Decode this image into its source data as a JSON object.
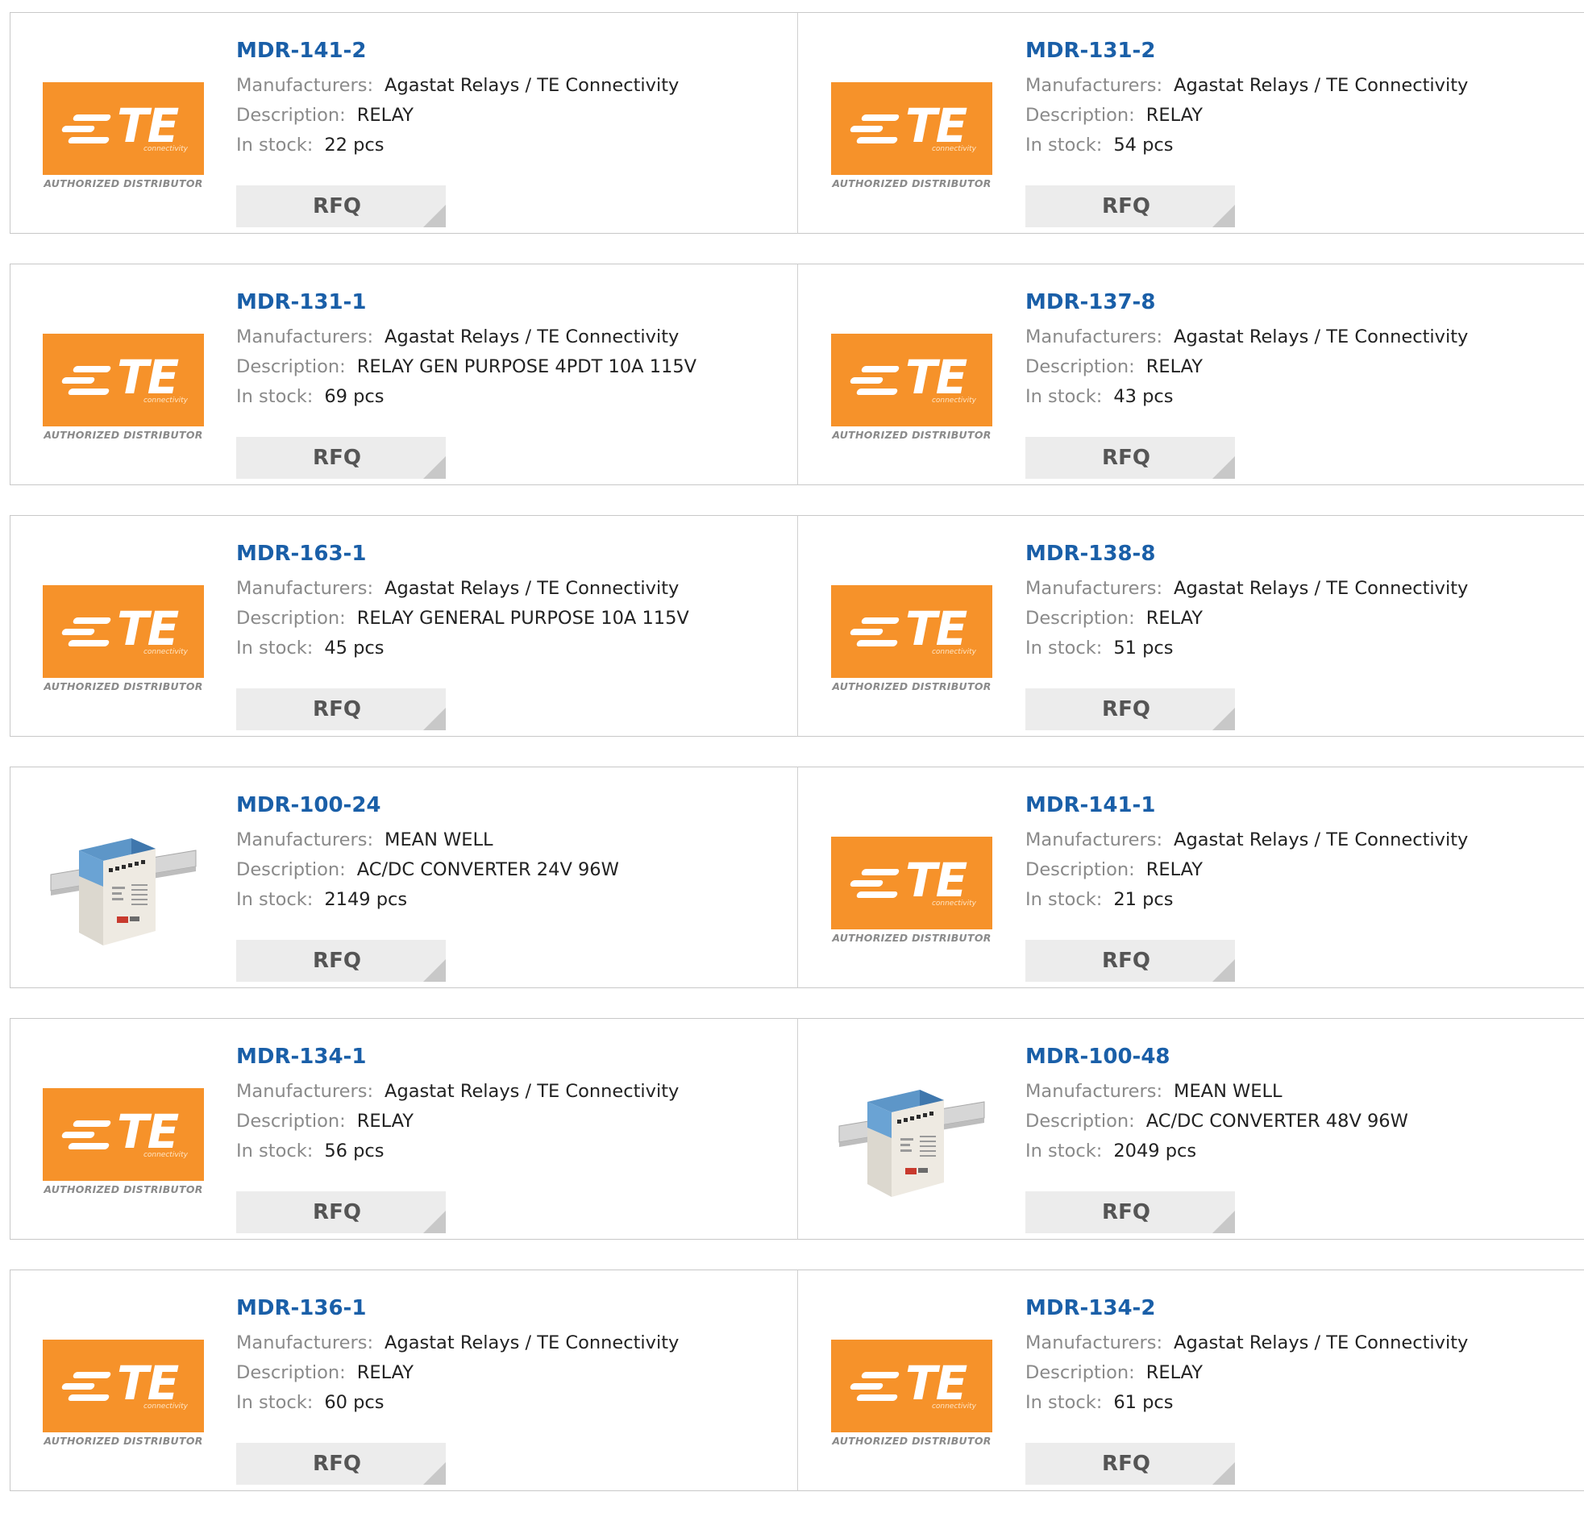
{
  "labels": {
    "manufacturers": "Manufacturers:",
    "description": "Description:",
    "in_stock": "In stock:",
    "rfq": "RFQ"
  },
  "logo": {
    "brand": "TE",
    "sub": "connectivity",
    "authorized": "AUTHORIZED DISTRIBUTOR",
    "color": "#f6922a"
  },
  "accent": "#1a5fa8",
  "products": [
    {
      "part": "MDR-141-2",
      "manufacturer": "Agastat Relays / TE Connectivity",
      "description": "RELAY",
      "stock": "22 pcs",
      "image": "te-logo"
    },
    {
      "part": "MDR-131-2",
      "manufacturer": "Agastat Relays / TE Connectivity",
      "description": "RELAY",
      "stock": "54 pcs",
      "image": "te-logo"
    },
    {
      "part": "MDR-131-1",
      "manufacturer": "Agastat Relays / TE Connectivity",
      "description": "RELAY GEN PURPOSE 4PDT 10A 115V",
      "stock": "69 pcs",
      "image": "te-logo"
    },
    {
      "part": "MDR-137-8",
      "manufacturer": "Agastat Relays / TE Connectivity",
      "description": "RELAY",
      "stock": "43 pcs",
      "image": "te-logo"
    },
    {
      "part": "MDR-163-1",
      "manufacturer": "Agastat Relays / TE Connectivity",
      "description": "RELAY GENERAL PURPOSE 10A 115V",
      "stock": "45 pcs",
      "image": "te-logo"
    },
    {
      "part": "MDR-138-8",
      "manufacturer": "Agastat Relays / TE Connectivity",
      "description": "RELAY",
      "stock": "51 pcs",
      "image": "te-logo"
    },
    {
      "part": "MDR-100-24",
      "manufacturer": "MEAN WELL",
      "description": "AC/DC CONVERTER 24V 96W",
      "stock": "2149 pcs",
      "image": "psu-photo"
    },
    {
      "part": "MDR-141-1",
      "manufacturer": "Agastat Relays / TE Connectivity",
      "description": "RELAY",
      "stock": "21 pcs",
      "image": "te-logo"
    },
    {
      "part": "MDR-134-1",
      "manufacturer": "Agastat Relays / TE Connectivity",
      "description": "RELAY",
      "stock": "56 pcs",
      "image": "te-logo"
    },
    {
      "part": "MDR-100-48",
      "manufacturer": "MEAN WELL",
      "description": "AC/DC CONVERTER 48V 96W",
      "stock": "2049 pcs",
      "image": "psu-photo"
    },
    {
      "part": "MDR-136-1",
      "manufacturer": "Agastat Relays / TE Connectivity",
      "description": "RELAY",
      "stock": "60 pcs",
      "image": "te-logo"
    },
    {
      "part": "MDR-134-2",
      "manufacturer": "Agastat Relays / TE Connectivity",
      "description": "RELAY",
      "stock": "61 pcs",
      "image": "te-logo"
    }
  ]
}
